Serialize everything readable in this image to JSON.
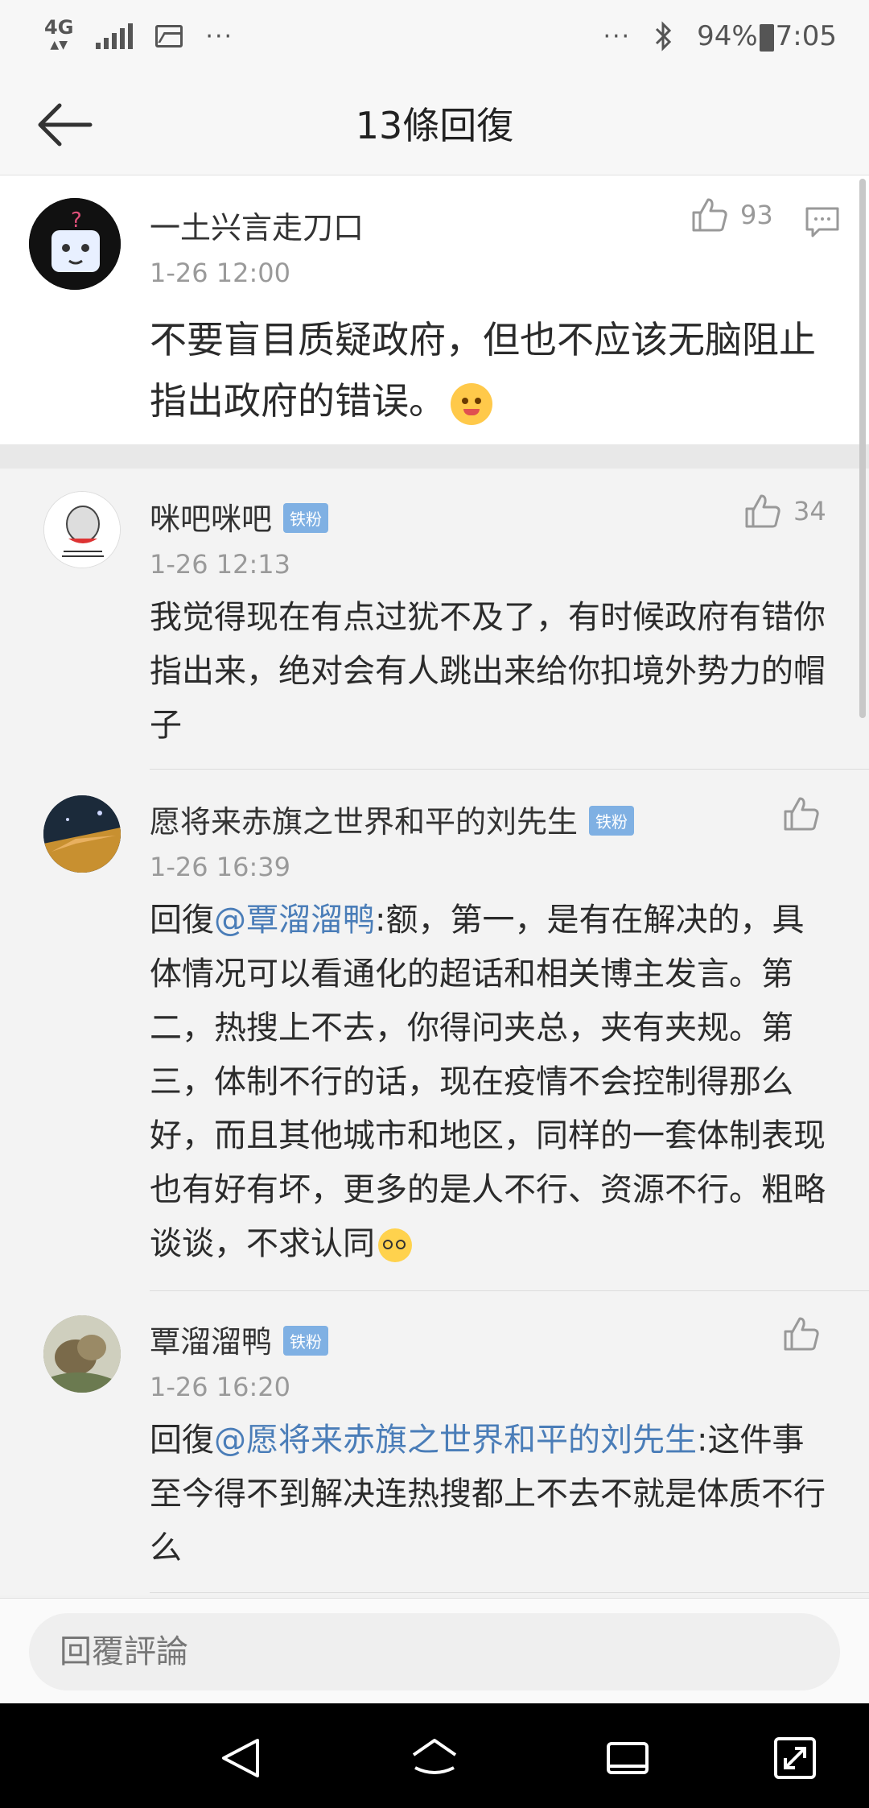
{
  "status_bar": {
    "network": "4G",
    "dots_left": "···",
    "dots_right": "···",
    "battery": "94%",
    "time": "7:05"
  },
  "header": {
    "title": "13條回復"
  },
  "main_comment": {
    "author": "一土兴言走刀口",
    "time": "1-26 12:00",
    "likes": "93",
    "text": "不要盲目质疑政府，但也不应该无脑阻止指出政府的错误。"
  },
  "replies": [
    {
      "author": "咪吧咪吧",
      "badge": "铁粉",
      "time": "1-26 12:13",
      "likes": "34",
      "text": "我觉得现在有点过犹不及了，有时候政府有错你指出来，绝对会有人跳出来给你扣境外势力的帽子"
    },
    {
      "author": "愿将来赤旗之世界和平的刘先生",
      "badge": "铁粉",
      "time": "1-26 16:39",
      "likes": "",
      "reply_prefix": "回復",
      "mention": "@覃溜溜鸭",
      "text": ":额，第一，是有在解决的，具体情况可以看通化的超话和相关博主发言。第二，热搜上不去，你得问夹总，夹有夹规。第三，体制不行的话，现在疫情不会控制得那么好，而且其他城市和地区，同样的一套体制表现也有好有坏，更多的是人不行、资源不行。粗略谈谈，不求认同"
    },
    {
      "author": "覃溜溜鸭",
      "badge": "铁粉",
      "time": "1-26 16:20",
      "likes": "",
      "reply_prefix": "回復",
      "mention": "@愿将来赤旗之世界和平的刘先生",
      "text": ":这件事至今得不到解决连热搜都上不去不就是体质不行么"
    }
  ],
  "input": {
    "placeholder": "回覆評論"
  },
  "icons": {
    "back": "arrow-left-icon",
    "like": "thumbs-up-icon",
    "comment": "comment-icon",
    "nav_back": "triangle-back-icon",
    "nav_home": "home-icon",
    "nav_recents": "recents-icon",
    "nav_expand": "expand-icon"
  },
  "colors": {
    "badge": "#7fb0e3",
    "mention": "#4a7db8"
  }
}
